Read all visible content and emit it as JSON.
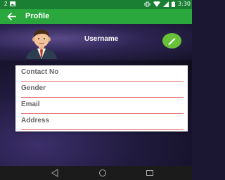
{
  "statusbar": {
    "time": "3:30",
    "left_label": "2"
  },
  "appbar": {
    "title": "Profile"
  },
  "profile": {
    "username": "Username"
  },
  "fields": [
    {
      "label": "Contact No"
    },
    {
      "label": "Gender"
    },
    {
      "label": "Email"
    },
    {
      "label": "Address"
    }
  ],
  "colors": {
    "statusbar": "#1a7f33",
    "appbar": "#2aa83e",
    "fab": "#67c23a",
    "field_underline": "#e57373"
  },
  "icons": {
    "back": "arrow-left-icon",
    "edit": "pencil-icon"
  }
}
